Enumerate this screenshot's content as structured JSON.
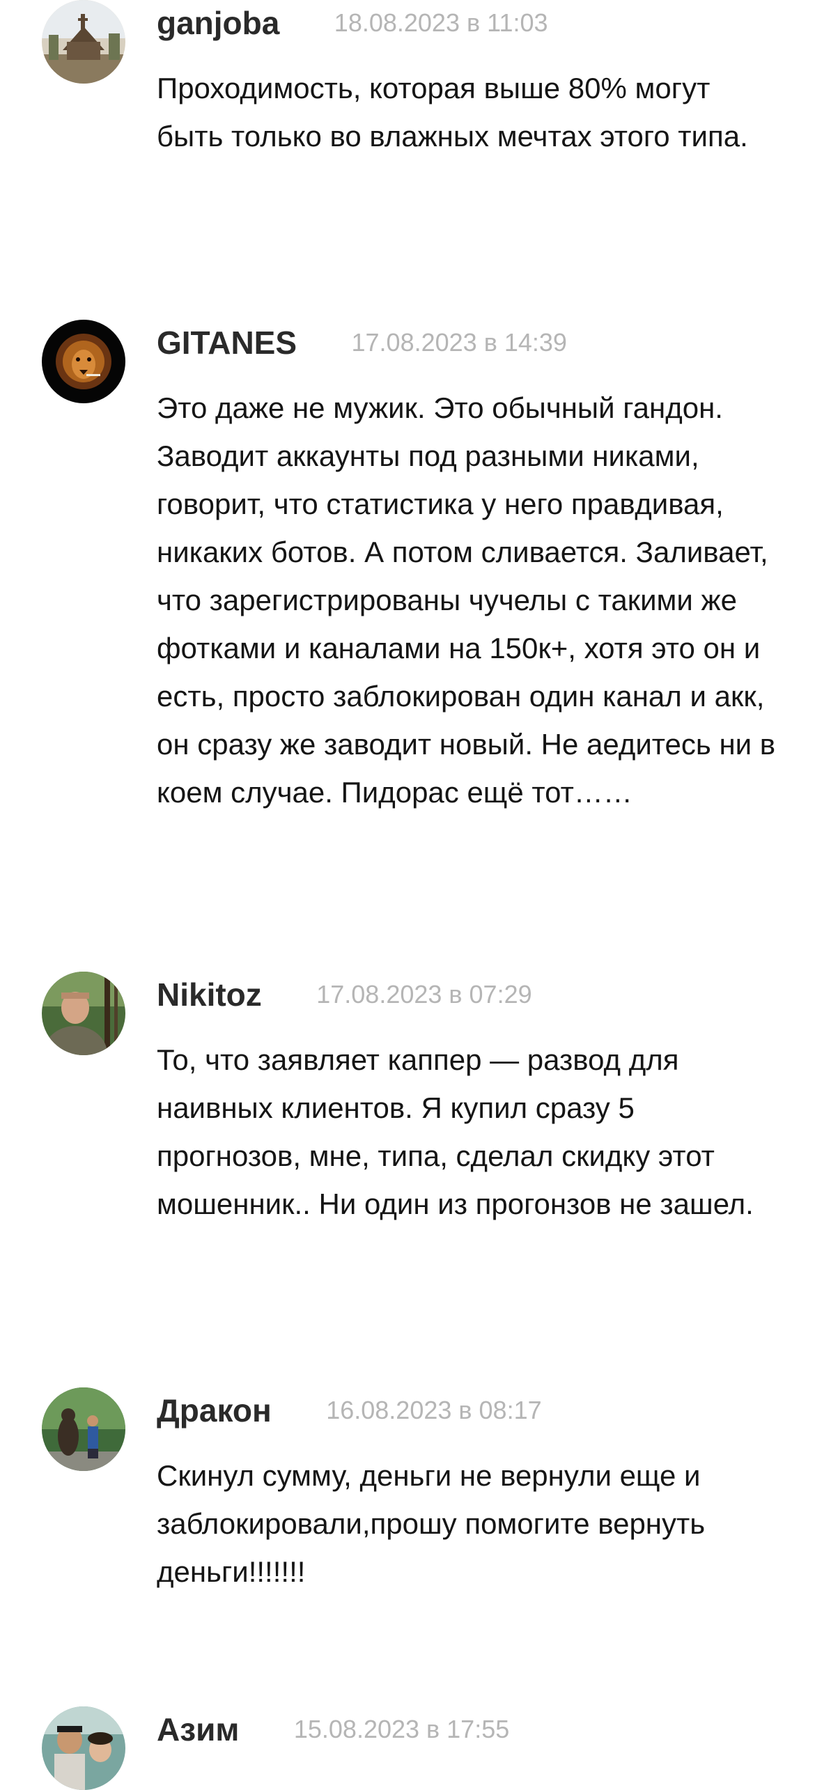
{
  "comments": [
    {
      "author": "ganjoba",
      "date": "18.08.2023 в 11:03",
      "text": "Проходимость, которая выше 80% могут быть только во влажных мечтах этого типа.",
      "avatar": "church-photo-avatar"
    },
    {
      "author": "GITANES",
      "date": "17.08.2023 в 14:39",
      "text": "Это даже не мужик. Это обычный гандон. Заводит аккаунты под разными никами, говорит, что статистика у него правдивая, никаких ботов. А потом сливается. Заливает, что зарегистрированы чучелы с такими же фотками и каналами на 150к+, хотя это он и есть, просто заблокирован один канал и акк, он сразу же заводит новый. Не аедитесь ни в коем случае. Пидорас ещё тот……",
      "avatar": "lion-avatar"
    },
    {
      "author": "Nikitoz",
      "date": "17.08.2023 в 07:29",
      "text": "То, что заявляет каппер — развод для наивных клиентов. Я купил сразу 5 прогнозов, мне, типа, сделал скидку этот мошенник.. Ни один из прогонзов не зашел.",
      "avatar": "man-in-forest-avatar"
    },
    {
      "author": "Дракон",
      "date": "16.08.2023 в 08:17",
      "text": "Скинул сумму, деньги не вернули еще и заблокировали,прошу помогите вернуть деньги!!!!!!!",
      "avatar": "bear-statue-avatar"
    },
    {
      "author": "Азим",
      "date": "15.08.2023 в 17:55",
      "text": "",
      "avatar": "family-photo-avatar"
    }
  ]
}
